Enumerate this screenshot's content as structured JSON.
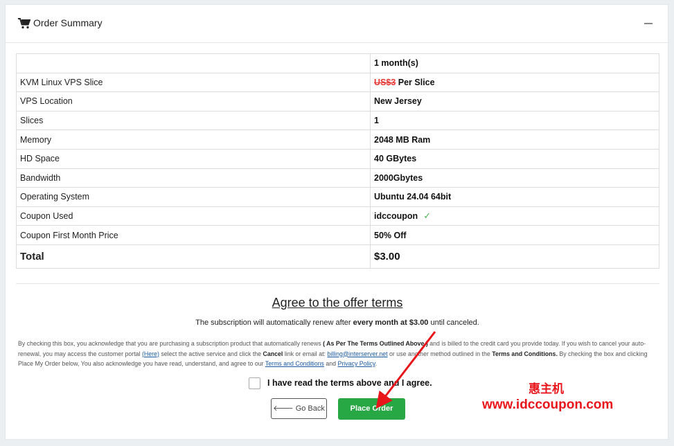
{
  "header": {
    "title": "Order Summary",
    "cart_icon": "shopping-cart-icon",
    "collapse_icon": "minus-icon"
  },
  "table": {
    "period": "1 month(s)",
    "rows": [
      {
        "label": "KVM Linux VPS Slice",
        "price_strike": "US$3",
        "value": " Per Slice"
      },
      {
        "label": "VPS Location",
        "value": "New Jersey"
      },
      {
        "label": "Slices",
        "value": "1"
      },
      {
        "label": "Memory",
        "value": "2048 MB Ram"
      },
      {
        "label": "HD Space",
        "value": "40 GBytes"
      },
      {
        "label": "Bandwidth",
        "value": "2000Gbytes"
      },
      {
        "label": "Operating System",
        "value": "Ubuntu 24.04 64bit"
      },
      {
        "label": "Coupon Used",
        "value": "idccoupon",
        "check": "✓"
      },
      {
        "label": "Coupon First Month Price",
        "value": "50% Off"
      }
    ],
    "total_label": "Total",
    "total_value": "$3.00"
  },
  "terms": {
    "heading": "Agree to the offer terms",
    "renew_pre": "The subscription will automatically renew after ",
    "renew_bold": "every month at $3.00",
    "renew_post": " until canceled.",
    "fine_1": "By checking this box, you acknowledge that you are purchasing a subscription product that automatically renews ",
    "fine_bold_1": "( As Per The Terms Outlined Above )",
    "fine_2": " and is billed to the credit card you provide today. If you wish to cancel your auto-renewal, you may access the customer portal ",
    "fine_link_here": "(Here)",
    "fine_3": " select the active service and click the ",
    "fine_bold_cancel": "Cancel",
    "fine_4": " link or email at: ",
    "fine_link_email": "billing@interserver.net",
    "fine_5": " or use another method outlined in the ",
    "fine_bold_terms": "Terms and Conditions.",
    "fine_6": " By checking the box and clicking Place My Order below, You also acknowledge you have read, understand, and agree to our ",
    "fine_link_tc": "Terms and Conditions",
    "fine_7": " and ",
    "fine_link_privacy": "Privacy Policy",
    "fine_8": ".",
    "agree_label": "I have read the terms above and I agree."
  },
  "buttons": {
    "back_label": "Go Back",
    "back_icon": "arrow-left-icon",
    "order_label": "Place Order"
  },
  "watermark": {
    "line1": "惠主机",
    "line2": "www.idccoupon.com"
  },
  "colors": {
    "accent_green": "#28a745",
    "strike_red": "#e53935",
    "watermark_red": "#e8161b"
  }
}
